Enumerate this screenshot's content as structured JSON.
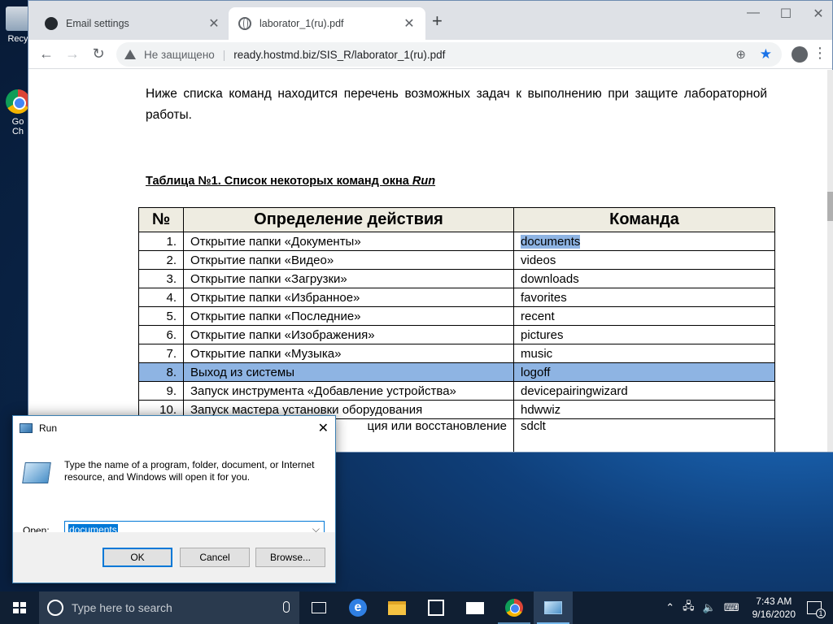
{
  "desktop": {
    "icons": [
      {
        "label": "Recy"
      },
      {
        "label": "Go\nCh"
      }
    ]
  },
  "browser": {
    "tabs": [
      {
        "label": "Email settings",
        "icon": "github-icon"
      },
      {
        "label": "laborator_1(ru).pdf",
        "icon": "globe-icon"
      }
    ],
    "window_controls": {
      "minimize": "—",
      "maximize": "☐",
      "close": "✕"
    },
    "toolbar": {
      "back": "←",
      "forward": "→",
      "reload": "↻",
      "security_label": "Не защищено",
      "separator": "|",
      "url": "ready.hostmd.biz/SIS_R/laborator_1(ru).pdf"
    }
  },
  "pdf": {
    "intro": "Ниже списка команд находится перечень возможных задач к выполнению при защите лабораторной работы.",
    "table_title_prefix": "Таблица №1. Список некоторых команд окна ",
    "table_title_run": "Run",
    "table": {
      "headers": [
        "№",
        "Определение действия",
        "Команда"
      ],
      "rows": [
        {
          "num": "1.",
          "action": "Открытие папки «Документы»",
          "command": "documents"
        },
        {
          "num": "2.",
          "action": "Открытие папки «Видео»",
          "command": "videos"
        },
        {
          "num": "3.",
          "action": "Открытие папки «Загрузки»",
          "command": "downloads"
        },
        {
          "num": "4.",
          "action": "Открытие папки «Избранное»",
          "command": "favorites"
        },
        {
          "num": "5.",
          "action": "Открытие папки «Последние»",
          "command": "recent"
        },
        {
          "num": "6.",
          "action": "Открытие папки «Изображения»",
          "command": "pictures"
        },
        {
          "num": "7.",
          "action": "Открытие папки «Музыка»",
          "command": "music"
        },
        {
          "num": "8.",
          "action": "Выход из системы",
          "command": "logoff"
        },
        {
          "num": "9.",
          "action": "Запуск инструмента «Добавление устройства»",
          "command": "devicepairingwizard"
        },
        {
          "num": "10.",
          "action": "Запуск мастера установки оборудования",
          "command": "hdwwiz"
        },
        {
          "num": "",
          "action": "ция или восстановление",
          "command": "sdclt"
        }
      ]
    }
  },
  "run_dialog": {
    "title": "Run",
    "description": "Type the name of a program, folder, document, or Internet resource, and Windows will open it for you.",
    "open_label": "Open:",
    "input_value": "documents",
    "ok_label": "OK",
    "cancel_label": "Cancel",
    "browse_label": "Browse..."
  },
  "taskbar": {
    "search_placeholder": "Type here to search",
    "time": "7:43 AM",
    "date": "9/16/2020",
    "notification_count": "1"
  },
  "colors": {
    "highlight_row": "#8eb4e3",
    "header_bg": "#eeece1",
    "accent": "#0078d7"
  }
}
